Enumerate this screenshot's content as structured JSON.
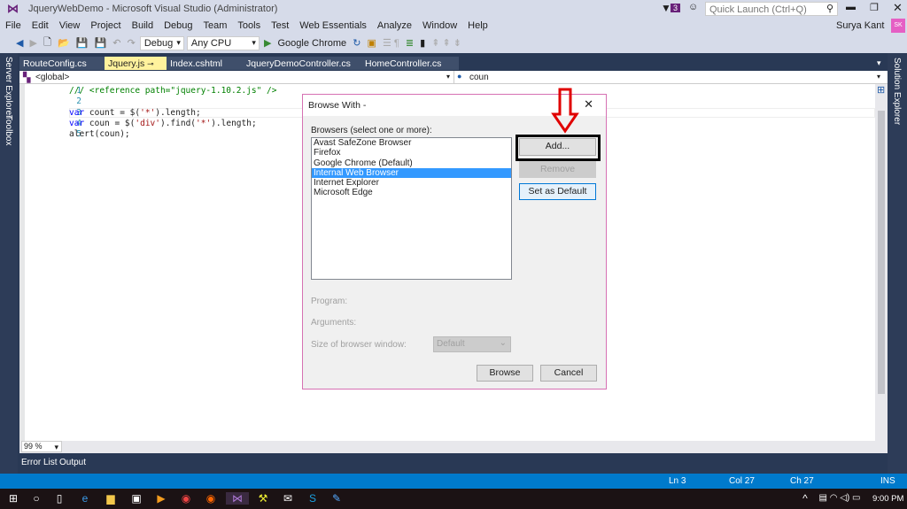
{
  "window": {
    "title": "JqueryWebDemo - Microsoft Visual Studio (Administrator)",
    "notification_count": "3",
    "quick_launch_placeholder": "Quick Launch (Ctrl+Q)",
    "user": "Surya Kant",
    "user_initials": "SK"
  },
  "menu": [
    "File",
    "Edit",
    "View",
    "Project",
    "Build",
    "Debug",
    "Team",
    "Tools",
    "Test",
    "Web Essentials",
    "Analyze",
    "Window",
    "Help"
  ],
  "toolbar": {
    "config": "Debug",
    "platform": "Any CPU",
    "run_target": "Google Chrome"
  },
  "side_left": [
    "Server Explorer",
    "Toolbox"
  ],
  "side_right": [
    "Solution Explorer"
  ],
  "tabs": [
    {
      "label": "RouteConfig.cs"
    },
    {
      "label": "Jquery.js",
      "active": true
    },
    {
      "label": "Index.cshtml"
    },
    {
      "label": "JqueryDemoController.cs"
    },
    {
      "label": "HomeController.cs"
    }
  ],
  "navbar": {
    "scope": "<global>",
    "member": "coun"
  },
  "code": {
    "lines": [
      "1",
      "2",
      "3",
      "4",
      "5"
    ],
    "l1": "/// <reference path=\"jquery-1.10.2.js\" />",
    "l3a": "var",
    " l3b": "",
    "l3": " count = $(",
    "l3s": "'*'",
    "l3e": ").length;",
    "l4": " coun = $(",
    "l4s": "'div'",
    "l4m": ").find(",
    "l4s2": "'*'",
    "l4e": ").length;",
    "l5": "alert(coun);"
  },
  "zoom": "99 %",
  "bottom_tabs": [
    "Error List",
    "Output"
  ],
  "status": {
    "ln": "Ln 3",
    "col": "Col 27",
    "ch": "Ch 27",
    "mode": "INS"
  },
  "taskbar": {
    "time": "9:00 PM"
  },
  "dialog": {
    "title": "Browse With -",
    "browsers_label": "Browsers (select one or more):",
    "browsers": [
      "Avast SafeZone Browser",
      "Firefox",
      "Google Chrome (Default)",
      "Internal Web Browser",
      "Internet Explorer",
      "Microsoft Edge"
    ],
    "selected": "Internal Web Browser",
    "add": "Add...",
    "remove": "Remove",
    "set_default": "Set as Default",
    "program_label": "Program:",
    "arguments_label": "Arguments:",
    "size_label": "Size of browser window:",
    "size_value": "Default",
    "browse": "Browse",
    "cancel": "Cancel"
  },
  "colors": {
    "accent": "#007acc",
    "highlight_arrow": "#e00000",
    "selection": "#3399ff"
  }
}
